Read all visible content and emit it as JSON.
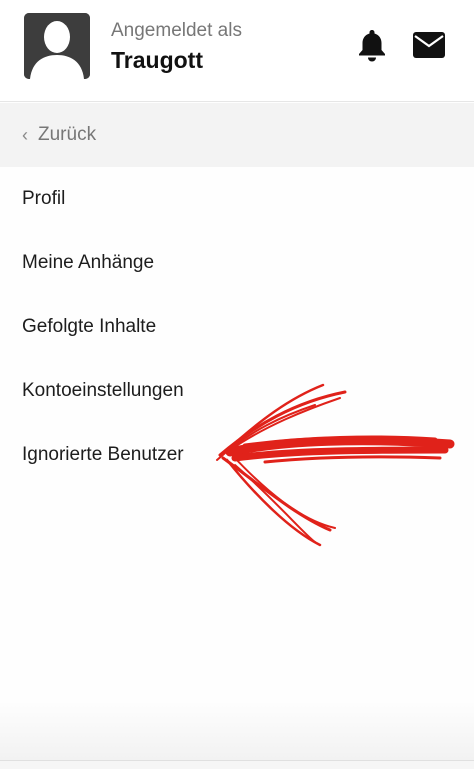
{
  "header": {
    "signed_in_label": "Angemeldet als",
    "username": "Traugott",
    "icons": [
      "bell-icon",
      "mail-icon"
    ]
  },
  "nav": {
    "back_label": "Zurück"
  },
  "menu": {
    "items": [
      {
        "label": "Profil"
      },
      {
        "label": "Meine Anhänge"
      },
      {
        "label": "Gefolgte Inhalte"
      },
      {
        "label": "Kontoeinstellungen"
      },
      {
        "label": "Ignorierte Benutzer"
      }
    ]
  },
  "annotation": {
    "color": "#e0221a",
    "shape": "hand-drawn-arrow"
  }
}
